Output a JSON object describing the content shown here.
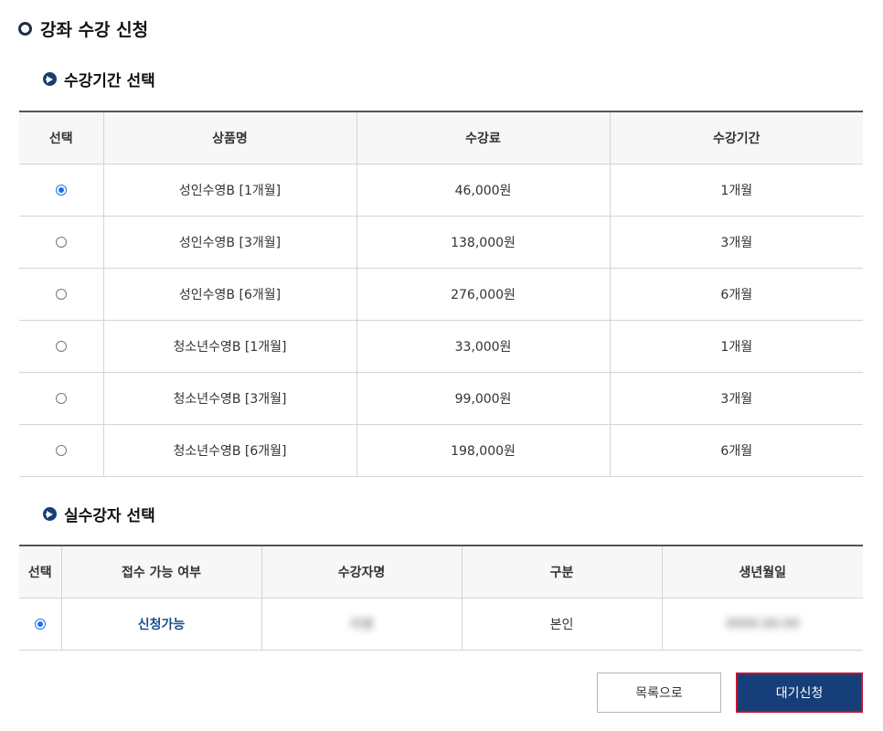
{
  "page": {
    "title": "강좌 수강 신청"
  },
  "period_section": {
    "title": "수강기간 선택",
    "headers": [
      "선택",
      "상품명",
      "수강료",
      "수강기간"
    ],
    "rows": [
      {
        "selected": true,
        "product": "성인수영B [1개월]",
        "fee": "46,000원",
        "period": "1개월"
      },
      {
        "selected": false,
        "product": "성인수영B [3개월]",
        "fee": "138,000원",
        "period": "3개월"
      },
      {
        "selected": false,
        "product": "성인수영B [6개월]",
        "fee": "276,000원",
        "period": "6개월"
      },
      {
        "selected": false,
        "product": "청소년수영B [1개월]",
        "fee": "33,000원",
        "period": "1개월"
      },
      {
        "selected": false,
        "product": "청소년수영B [3개월]",
        "fee": "99,000원",
        "period": "3개월"
      },
      {
        "selected": false,
        "product": "청소년수영B [6개월]",
        "fee": "198,000원",
        "period": "6개월"
      }
    ]
  },
  "student_section": {
    "title": "실수강자 선택",
    "headers": [
      "선택",
      "접수 가능 여부",
      "수강자명",
      "구분",
      "생년월일"
    ],
    "rows": [
      {
        "selected": true,
        "status": "신청가능",
        "name": "이영",
        "type": "본인",
        "birth": "0000.00.00"
      }
    ]
  },
  "buttons": {
    "list": "목록으로",
    "waitlist": "대기신청"
  },
  "colors": {
    "accent": "#163f7a",
    "radio": "#1a73e8",
    "button_border": "#c8102e"
  }
}
